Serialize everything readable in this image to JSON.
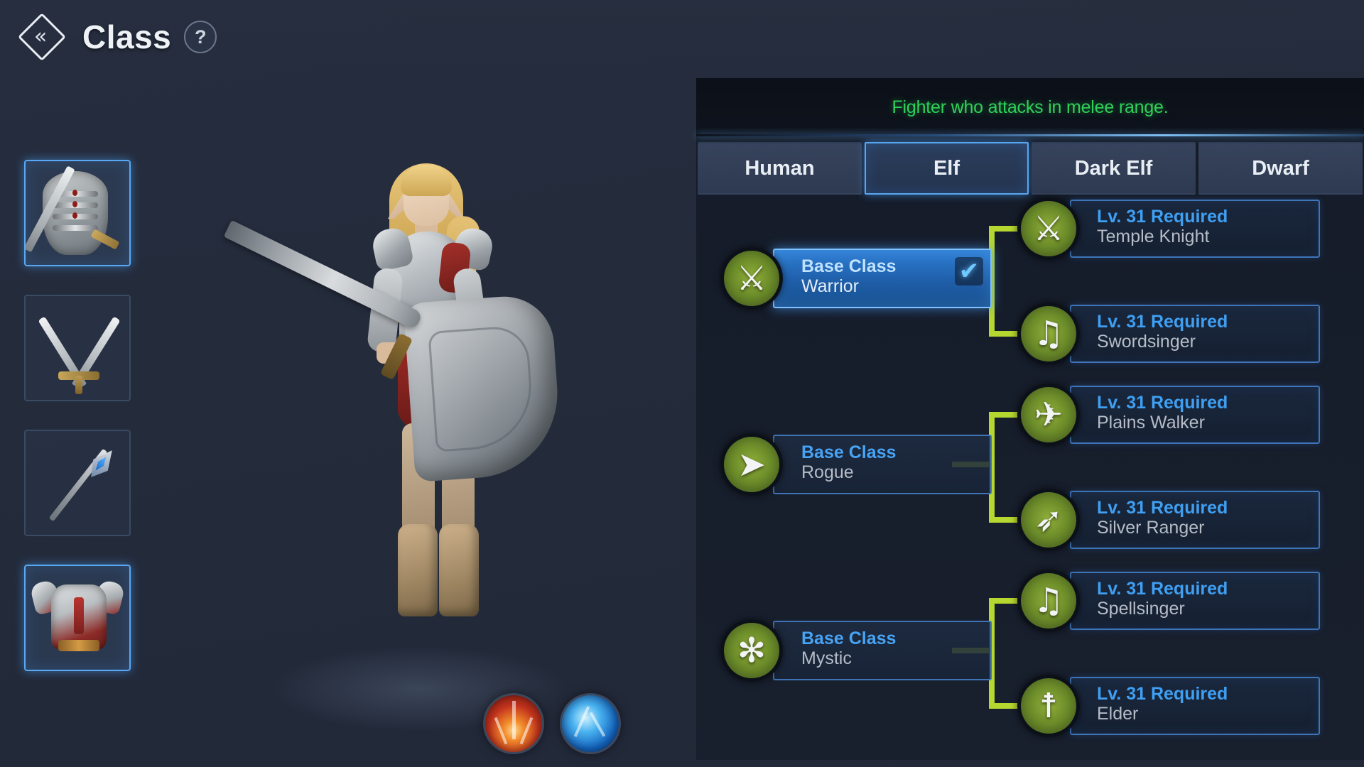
{
  "header": {
    "back_icon": "double-chevron-left-icon",
    "title": "Class",
    "help_icon": "question-mark-icon"
  },
  "item_rail": {
    "items": [
      {
        "name": "breastplate-with-sword",
        "icon": "ribcage-armor-icon",
        "selected": true
      },
      {
        "name": "crossed-swords",
        "icon": "crossed-swords-icon",
        "selected": false
      },
      {
        "name": "blue-spear",
        "icon": "spear-icon",
        "selected": false
      },
      {
        "name": "red-heavy-armor",
        "icon": "heavy-armor-icon",
        "selected": true
      }
    ]
  },
  "stage": {
    "orbs": [
      {
        "name": "fire-orb",
        "element": "fire",
        "color": "#d2451f"
      },
      {
        "name": "ice-orb",
        "element": "ice",
        "color": "#2a8fe0"
      }
    ]
  },
  "right_panel": {
    "description": "Fighter who attacks in melee range.",
    "description_color": "#2fd158",
    "tabs": [
      {
        "label": "Human",
        "active": false
      },
      {
        "label": "Elf",
        "active": true
      },
      {
        "label": "Dark Elf",
        "active": false
      },
      {
        "label": "Dwarf",
        "active": false
      }
    ],
    "groups": [
      {
        "base": {
          "kicker": "Base Class",
          "name": "Warrior",
          "icon": "shield-and-swords-icon",
          "glyph": "⚔",
          "selected": true,
          "checked": true,
          "check_glyph": "✔"
        },
        "advanced": [
          {
            "kicker": "Lv. 31 Required",
            "name": "Temple Knight",
            "icon": "crossed-swords-arrow-icon",
            "glyph": "⚔"
          },
          {
            "kicker": "Lv. 31 Required",
            "name": "Swordsinger",
            "icon": "sword-and-harp-icon",
            "glyph": "♫"
          }
        ]
      },
      {
        "base": {
          "kicker": "Base Class",
          "name": "Rogue",
          "icon": "winged-boot-icon",
          "glyph": "➤",
          "selected": false,
          "checked": false,
          "check_glyph": ""
        },
        "advanced": [
          {
            "kicker": "Lv. 31 Required",
            "name": "Plains Walker",
            "icon": "winged-dagger-icon",
            "glyph": "✈"
          },
          {
            "kicker": "Lv. 31 Required",
            "name": "Silver Ranger",
            "icon": "bow-icon",
            "glyph": "➶"
          }
        ]
      },
      {
        "base": {
          "kicker": "Base Class",
          "name": "Mystic",
          "icon": "sun-spiral-icon",
          "glyph": "✻",
          "selected": false,
          "checked": false,
          "check_glyph": ""
        },
        "advanced": [
          {
            "kicker": "Lv. 31 Required",
            "name": "Spellsinger",
            "icon": "harp-icon",
            "glyph": "♫"
          },
          {
            "kicker": "Lv. 31 Required",
            "name": "Elder",
            "icon": "lantern-icon",
            "glyph": "☨"
          }
        ]
      }
    ]
  }
}
